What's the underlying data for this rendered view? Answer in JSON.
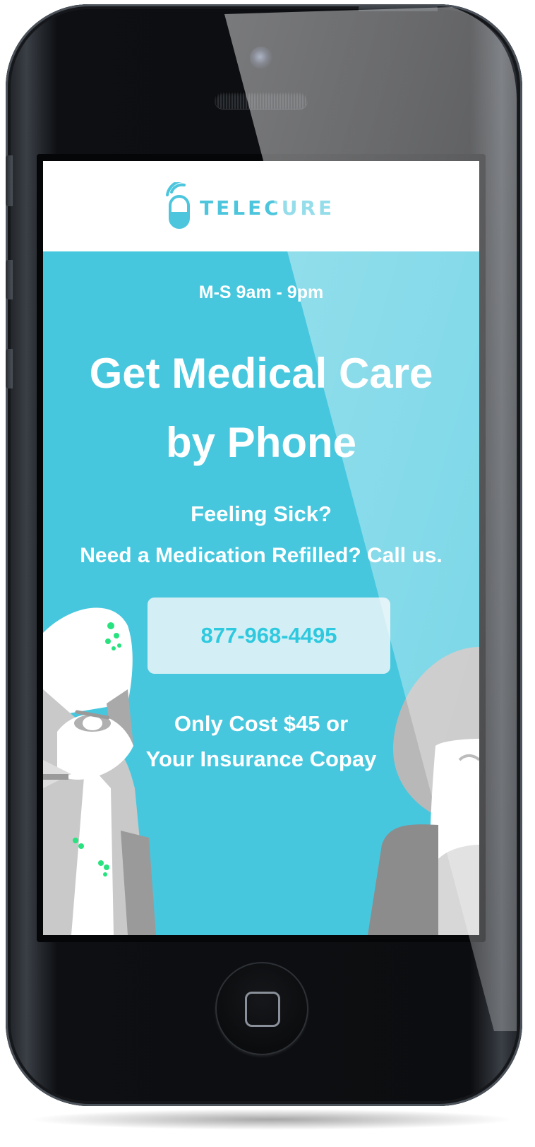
{
  "app": {
    "brand": "TELECURE"
  },
  "hero": {
    "hours": "M-S  9am - 9pm",
    "headline_line1": "Get Medical Care",
    "headline_line2": "by Phone",
    "subline1": "Feeling Sick?",
    "subline2": "Need a Medication Refilled? Call us.",
    "phone_number": "877-968-4495",
    "price_line1": "Only Cost $45 or",
    "price_line2": "Your Insurance Copay"
  },
  "colors": {
    "accent": "#46c7de",
    "button_bg": "#d3eff5",
    "button_text": "#2ec9df",
    "text_light": "#ffffff",
    "logo": "#4dc6dd",
    "device_body": "#0c0d10"
  },
  "icons": {
    "logo_icon": "pill-with-signal-icon",
    "home_button": "home-square-icon"
  }
}
